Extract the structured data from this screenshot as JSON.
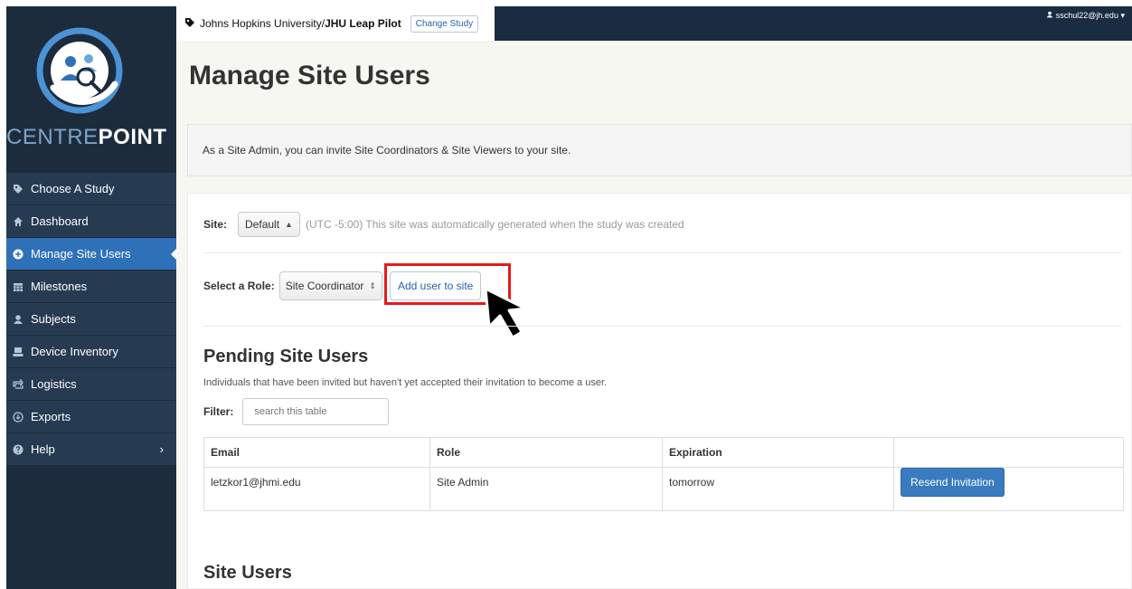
{
  "sidebar": {
    "brand_light": "CENTRE",
    "brand_bold": "POINT",
    "items": [
      {
        "label": "Choose A Study",
        "icon": "tag-icon"
      },
      {
        "label": "Dashboard",
        "icon": "home-icon"
      },
      {
        "label": "Manage Site Users",
        "icon": "plus-circle-icon"
      },
      {
        "label": "Milestones",
        "icon": "calendar-icon"
      },
      {
        "label": "Subjects",
        "icon": "user-icon"
      },
      {
        "label": "Device Inventory",
        "icon": "device-icon"
      },
      {
        "label": "Logistics",
        "icon": "logistics-icon"
      },
      {
        "label": "Exports",
        "icon": "export-icon"
      },
      {
        "label": "Help",
        "icon": "question-icon",
        "caret": "›"
      }
    ]
  },
  "topbar": {
    "crumb_prefix": "Johns Hopkins University/",
    "crumb_bold": "JHU Leap Pilot",
    "change_study": "Change Study",
    "user": "sschul22@jh.edu"
  },
  "page": {
    "title": "Manage Site Users",
    "info": "As a Site Admin, you can invite Site Coordinators & Site Viewers to your site."
  },
  "site": {
    "label": "Site:",
    "selected": "Default",
    "description": "(UTC -5:00) This site was automatically generated when the study was created"
  },
  "role": {
    "label": "Select a Role:",
    "selected": "Site Coordinator",
    "add_button": "Add user to site"
  },
  "pending": {
    "title": "Pending Site Users",
    "description": "Individuals that have been invited but haven't yet accepted their invitation to become a user.",
    "filter_label": "Filter:",
    "filter_placeholder": "search this table",
    "columns": [
      "Email",
      "Role",
      "Expiration",
      ""
    ],
    "rows": [
      {
        "email": "letzkor1@jhmi.edu",
        "role": "Site Admin",
        "expiration": "tomorrow",
        "action": "Resend Invitation"
      }
    ]
  },
  "site_users": {
    "title": "Site Users"
  },
  "colors": {
    "sidebar_bg": "#1d2c3d",
    "nav_bg": "#263b52",
    "active": "#2f71b8",
    "topbar_bg": "#1a2c42",
    "highlight": "#e41b1b",
    "primary_button": "#3a7bc0"
  }
}
